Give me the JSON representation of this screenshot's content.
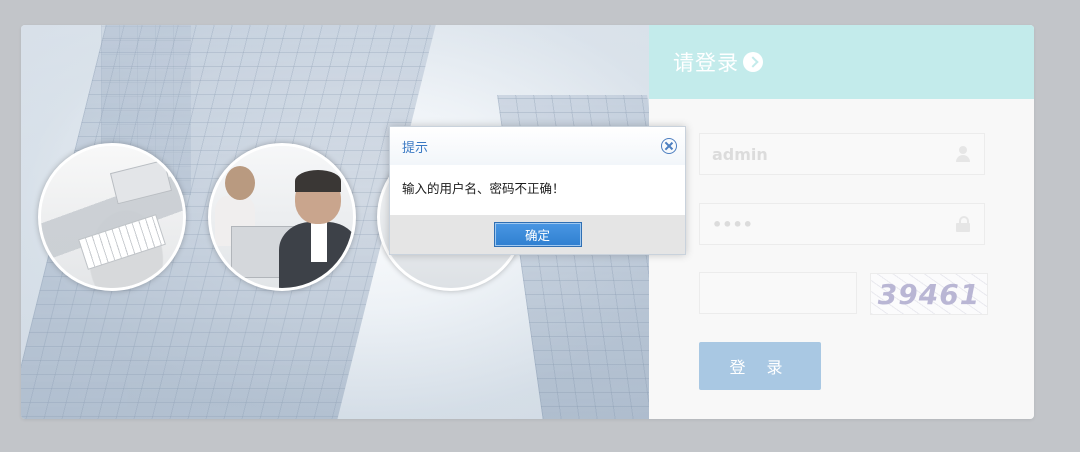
{
  "login": {
    "title": "请登录",
    "username": {
      "value": "admin"
    },
    "password": {
      "value": "••••"
    },
    "captcha": {
      "value": "",
      "code": "39461"
    },
    "submit_label": "登 录"
  },
  "dialog": {
    "title": "提示",
    "message": "输入的用户名、密码不正确！",
    "ok_label": "确定"
  },
  "colors": {
    "header_bg": "#c3ebeb",
    "button_bg": "#a9c8e3",
    "dialog_accent": "#3a79c3"
  }
}
